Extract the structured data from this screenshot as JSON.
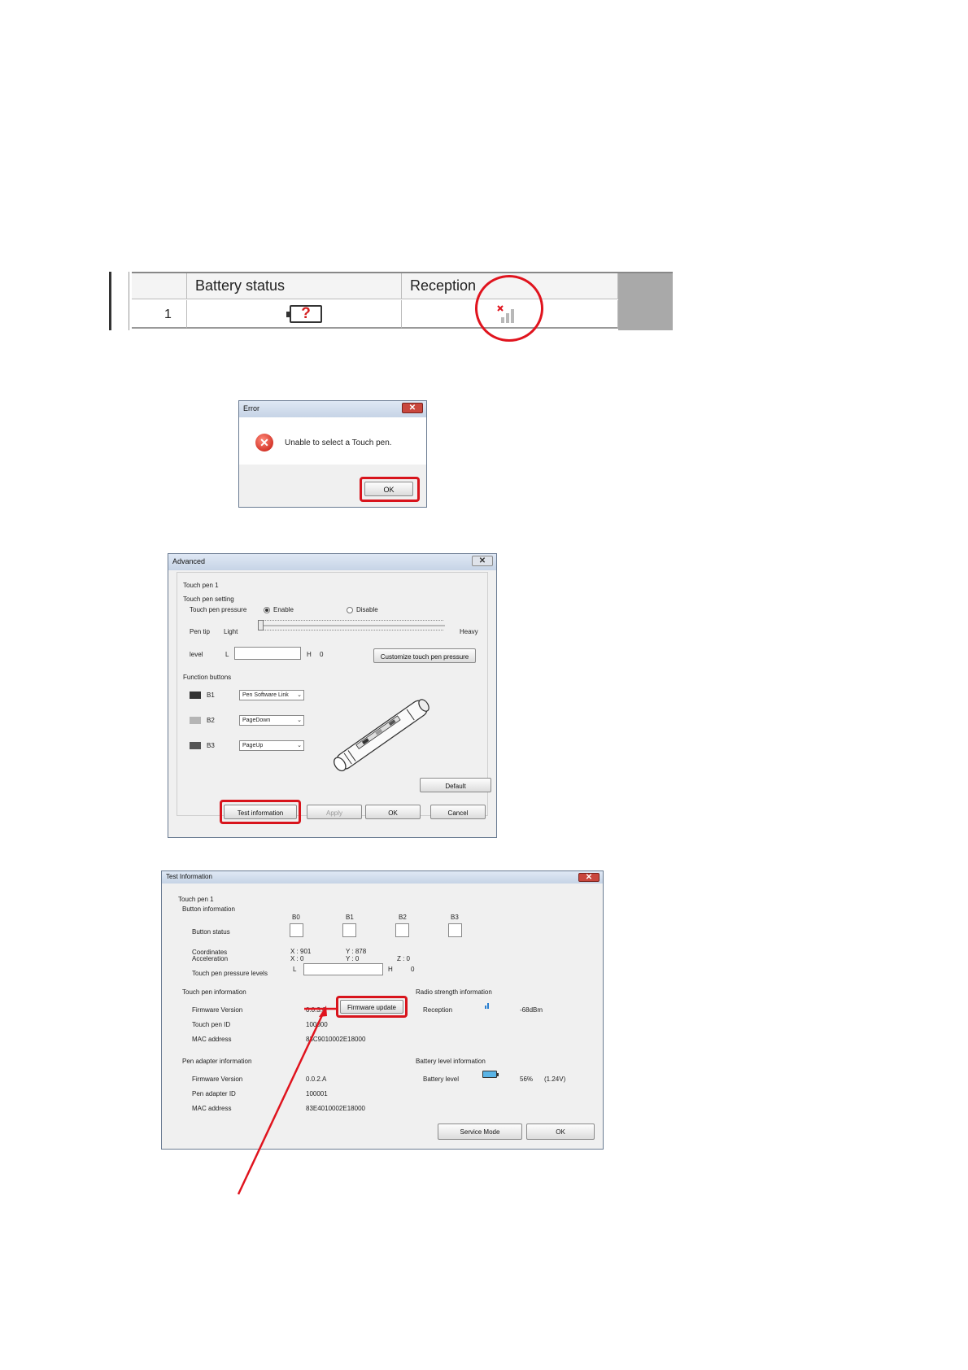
{
  "battery_table": {
    "col_battery": "Battery status",
    "col_reception": "Reception",
    "row_number": "1",
    "battery_value": "?"
  },
  "error_dialog": {
    "title": "Error",
    "close": "✕",
    "message": "Unable to select a Touch pen.",
    "ok": "OK"
  },
  "advanced_dialog": {
    "title": "Advanced",
    "close": "✕",
    "pen_name": "Touch pen 1",
    "setting_header": "Touch pen setting",
    "pressure_label": "Touch pen pressure",
    "enable": "Enable",
    "disable": "Disable",
    "pen_tip": "Pen tip",
    "light": "Light",
    "heavy": "Heavy",
    "level": "level",
    "level_l": "L",
    "level_h": "H",
    "level_h_value": "0",
    "customize": "Customize touch pen pressure",
    "function_header": "Function buttons",
    "buttons": [
      {
        "id": "B1",
        "value": "Pen Software Link",
        "color": "#333333"
      },
      {
        "id": "B2",
        "value": "PageDown",
        "color": "#b5b5b5"
      },
      {
        "id": "B3",
        "value": "PageUp",
        "color": "#555555"
      }
    ],
    "default": "Default",
    "test_information": "Test information",
    "apply": "Apply",
    "ok": "OK",
    "cancel": "Cancel"
  },
  "test_info_dialog": {
    "title": "Test Information",
    "close": "✕",
    "pen_name": "Touch pen 1",
    "button_info_header": "Button information",
    "button_status_label": "Button status",
    "button_ids": [
      "B0",
      "B1",
      "B2",
      "B3"
    ],
    "coordinates_label": "Coordinates",
    "acceleration_label": "Acceleration",
    "coord_x": "X : 901",
    "coord_y": "Y : 878",
    "accel_x": "X : 0",
    "accel_y": "Y : 0",
    "accel_z": "Z : 0",
    "pressure_levels_label": "Touch pen pressure levels",
    "pressure_l": "L",
    "pressure_h": "H",
    "pressure_h_value": "0",
    "pen_info_header": "Touch pen information",
    "pen_fw_label": "Firmware Version",
    "pen_fw_value": "0.0.3.6",
    "firmware_update": "Firmware update",
    "pen_id_label": "Touch pen ID",
    "pen_id_value": "100000",
    "pen_mac_label": "MAC address",
    "pen_mac_value": "83C9010002E18000",
    "radio_header": "Radio strength information",
    "reception_label": "Reception",
    "reception_value": "-68dBm",
    "adapter_header": "Pen adapter information",
    "adapter_fw_label": "Firmware Version",
    "adapter_fw_value": "0.0.2.A",
    "adapter_id_label": "Pen adapter ID",
    "adapter_id_value": "100001",
    "adapter_mac_label": "MAC address",
    "adapter_mac_value": "83E4010002E18000",
    "battery_header": "Battery level information",
    "battery_label": "Battery level",
    "battery_percent": "56%",
    "battery_voltage": "(1.24V)",
    "service_mode": "Service Mode",
    "ok": "OK"
  },
  "colors": {
    "highlight_red": "#d8141c",
    "annotation_red": "#e0141e"
  }
}
